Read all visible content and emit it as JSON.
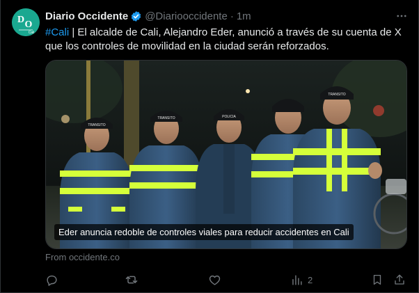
{
  "author": {
    "name": "Diario Occidente",
    "handle": "@Diariooccidente",
    "separator": "·",
    "time": "1m",
    "avatar": {
      "letters": "D O",
      "sub": "Cali",
      "bg": "#1aa890"
    },
    "verified_color": "#1d9bf0"
  },
  "tweet": {
    "hashtag": "#Cali",
    "text_line1": " | El alcalde de Cali, Alejandro Eder, anunció a través de su cuenta de X",
    "text_line2": "que los controles de movilidad en la ciudad serán reforzados."
  },
  "media": {
    "caption": "Eder anuncia redoble de controles viales para reducir accidentes en Cali",
    "vest_labels": [
      "TRANSITO",
      "POLICIA"
    ]
  },
  "card": {
    "source": "From occidente.co"
  },
  "actions": {
    "reply": {
      "icon": "reply-icon",
      "count": ""
    },
    "repost": {
      "icon": "repost-icon",
      "count": ""
    },
    "like": {
      "icon": "heart-icon",
      "count": ""
    },
    "views": {
      "icon": "views-chart-icon",
      "count": "2"
    },
    "bookmark": {
      "icon": "bookmark-icon"
    },
    "share": {
      "icon": "share-icon"
    }
  },
  "more": {
    "icon": "more-dots-icon"
  },
  "colors": {
    "accent": "#1d9bf0",
    "muted": "#71767b",
    "text": "#e7e9ea",
    "bg": "#000000"
  }
}
